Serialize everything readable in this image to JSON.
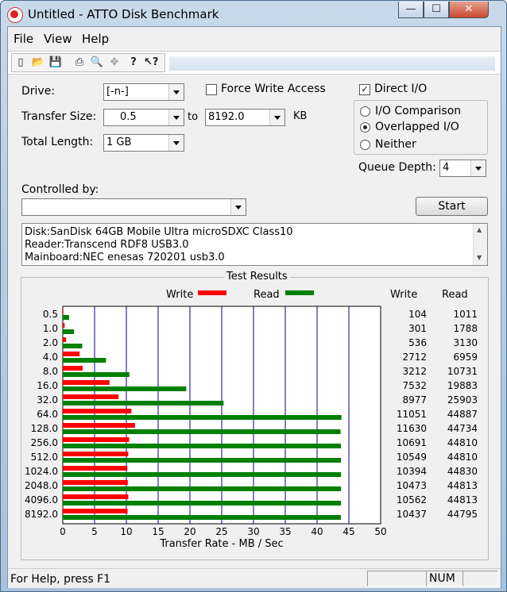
{
  "window": {
    "title": "Untitled - ATTO Disk Benchmark",
    "min_symbol": "—",
    "max_symbol": "☐",
    "close_symbol": "✕"
  },
  "menu": [
    "File",
    "View",
    "Help"
  ],
  "toolbar_icons": [
    "new-icon",
    "open-icon",
    "save-icon",
    "print-icon",
    "print-preview-icon",
    "move-icon",
    "help-icon",
    "context-help-icon"
  ],
  "settings": {
    "drive_label": "Drive:",
    "drive_value": "[-n-]",
    "force_write_label": "Force Write Access",
    "direct_io_label": "Direct I/O",
    "direct_io_checked": true,
    "transfer_size_label": "Transfer Size:",
    "transfer_from": "0.5",
    "to_label": "to",
    "transfer_to": "8192.0",
    "kb_label": "KB",
    "total_length_label": "Total Length:",
    "total_length_value": "1 GB",
    "io_comparison_label": "I/O Comparison",
    "overlapped_io_label": "Overlapped I/O",
    "neither_label": "Neither",
    "selected_mode": "Overlapped I/O",
    "queue_depth_label": "Queue Depth:",
    "queue_depth_value": "4",
    "controlled_by_label": "Controlled by:",
    "controlled_by_value": "",
    "start_label": "Start"
  },
  "info_lines": [
    "Disk:SanDisk 64GB Mobile Ultra microSDXC Class10",
    "Reader:Transcend RDF8 USB3.0",
    "Mainboard:NEC enesas 720201 usb3.0"
  ],
  "results": {
    "title": "Test Results",
    "write_label": "Write",
    "read_label": "Read",
    "write_col_header": "Write",
    "read_col_header": "Read"
  },
  "chart_data": {
    "type": "bar",
    "orientation": "horizontal",
    "xlabel": "Transfer Rate - MB / Sec",
    "xlim": [
      0,
      50
    ],
    "xticks": [
      0,
      5,
      10,
      15,
      20,
      25,
      30,
      35,
      40,
      45,
      50
    ],
    "grid": true,
    "colors": {
      "write": "#ff0000",
      "read": "#008000"
    },
    "categories": [
      "0.5",
      "1.0",
      "2.0",
      "4.0",
      "8.0",
      "16.0",
      "32.0",
      "64.0",
      "128.0",
      "256.0",
      "512.0",
      "1024.0",
      "2048.0",
      "4096.0",
      "8192.0"
    ],
    "series": [
      {
        "name": "Write",
        "values": [
          104,
          301,
          536,
          2712,
          3212,
          7532,
          8977,
          11051,
          11630,
          10691,
          10549,
          10394,
          10473,
          10562,
          10437
        ]
      },
      {
        "name": "Read",
        "values": [
          1011,
          1788,
          3130,
          6959,
          10731,
          19883,
          25903,
          44887,
          44734,
          44810,
          44810,
          44830,
          44813,
          44813,
          44795
        ]
      }
    ]
  },
  "status": {
    "help_text": "For Help, press F1",
    "num_label": "NUM"
  }
}
